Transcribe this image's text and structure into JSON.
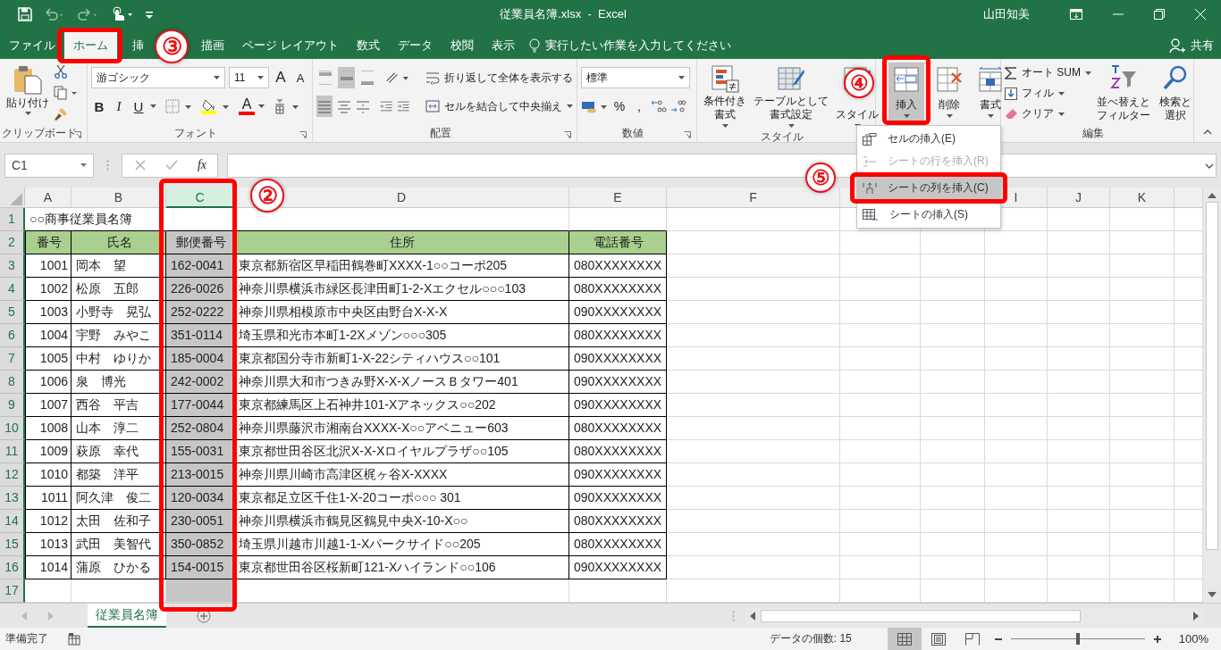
{
  "title_bar": {
    "title": "従業員名簿.xlsx  -  Excel",
    "user": "山田知美"
  },
  "tabs": [
    {
      "label": "ファイル",
      "selected": false,
      "highlighted": false
    },
    {
      "label": "ホーム",
      "selected": true,
      "highlighted": true,
      "callout": "③"
    },
    {
      "label": "挿",
      "selected": false,
      "highlighted": false
    },
    {
      "label": "描画",
      "selected": false,
      "highlighted": false
    },
    {
      "label": "ページ レイアウト",
      "selected": false,
      "highlighted": false
    },
    {
      "label": "数式",
      "selected": false,
      "highlighted": false
    },
    {
      "label": "データ",
      "selected": false,
      "highlighted": false
    },
    {
      "label": "校閲",
      "selected": false,
      "highlighted": false
    },
    {
      "label": "表示",
      "selected": false,
      "highlighted": false
    }
  ],
  "tell_me": {
    "placeholder": "実行したい作業を入力してください"
  },
  "share": "共有",
  "ribbon": {
    "clipboard": {
      "paste": "貼り付け",
      "label": "クリップボード"
    },
    "font": {
      "name": "游ゴシック",
      "size": "11",
      "grow": "A",
      "shrink": "A",
      "bold": "B",
      "italic": "I",
      "underline": "U",
      "font_color": "A",
      "label": "フォント"
    },
    "alignment": {
      "vertical": [
        {
          "selected": false
        },
        {
          "selected": true
        },
        {
          "selected": false
        }
      ],
      "horizontal": [
        {
          "selected": true
        },
        {
          "selected": false
        },
        {
          "selected": false
        }
      ],
      "wrap": "折り返して全体を表示する",
      "merge": "セルを結合して中央揃え",
      "label": "配置"
    },
    "number": {
      "format": "標準",
      "percent": "%",
      "comma": ",",
      "label": "数値"
    },
    "styles": {
      "buttons": [
        {
          "kind": "conditional",
          "lines": [
            "条件付き",
            "書式"
          ]
        },
        {
          "kind": "table",
          "lines": [
            "テーブルとして",
            "書式設定"
          ]
        },
        {
          "kind": "cell",
          "lines": [
            "スタイル"
          ]
        }
      ],
      "label": "スタイル"
    },
    "cells": {
      "buttons": [
        {
          "kind": "insert",
          "label": "挿入",
          "highlighted": true,
          "callout": "④"
        },
        {
          "kind": "delete",
          "label": "削除",
          "highlighted": false
        },
        {
          "kind": "format",
          "label": "書式",
          "highlighted": false
        }
      ]
    },
    "editing": {
      "rows": [
        {
          "kind": "sum",
          "label": "オート SUM"
        },
        {
          "kind": "fill",
          "label": "フィル"
        },
        {
          "kind": "clear",
          "label": "クリア"
        }
      ],
      "sort": [
        "並べ替えと",
        "フィルター"
      ],
      "find": [
        "検索と",
        "選択"
      ],
      "label": "編集"
    }
  },
  "formula_bar": {
    "name_box": "C1",
    "fx": "fx"
  },
  "column_headers": [
    {
      "label": "A",
      "selected": false,
      "highlighted": false
    },
    {
      "label": "B",
      "selected": false,
      "highlighted": false
    },
    {
      "label": "C",
      "selected": true,
      "highlighted": true,
      "callout": "②"
    },
    {
      "label": "D",
      "selected": false,
      "highlighted": false
    },
    {
      "label": "E",
      "selected": false,
      "highlighted": false
    },
    {
      "label": "F",
      "selected": false,
      "highlighted": false
    },
    {
      "label": "I",
      "selected": false,
      "highlighted": false
    },
    {
      "label": "J",
      "selected": false,
      "highlighted": false
    },
    {
      "label": "K",
      "selected": false,
      "highlighted": false
    }
  ],
  "rows": [
    {
      "number": "1",
      "kind": "title",
      "text": "○○商事従業員名簿"
    },
    {
      "number": "2",
      "kind": "header",
      "cells": [
        "番号",
        "氏名",
        "郵便番号",
        "住所",
        "電話番号"
      ]
    },
    {
      "number": "3",
      "kind": "data",
      "cells": [
        "1001",
        "岡本　望",
        "162-0041",
        "東京都新宿区早稲田鶴巻町XXXX-1○○コーポ205",
        "080XXXXXXXX"
      ]
    },
    {
      "number": "4",
      "kind": "data",
      "cells": [
        "1002",
        "松原　五郎",
        "226-0026",
        "神奈川県横浜市緑区長津田町1-2-Xエクセル○○○103",
        "080XXXXXXXX"
      ]
    },
    {
      "number": "5",
      "kind": "data",
      "cells": [
        "1003",
        "小野寺　晃弘",
        "252-0222",
        "神奈川県相模原市中央区由野台X-X-X",
        "090XXXXXXXX"
      ]
    },
    {
      "number": "6",
      "kind": "data",
      "cells": [
        "1004",
        "宇野　みやこ",
        "351-0114",
        "埼玉県和光市本町1-2Xメゾン○○○305",
        "080XXXXXXXX"
      ]
    },
    {
      "number": "7",
      "kind": "data",
      "cells": [
        "1005",
        "中村　ゆりか",
        "185-0004",
        "東京都国分寺市新町1-X-22シティハウス○○101",
        "090XXXXXXXX"
      ]
    },
    {
      "number": "8",
      "kind": "data",
      "cells": [
        "1006",
        "泉　博光",
        "242-0002",
        "神奈川県大和市つきみ野X-X-XノースＢタワー401",
        "090XXXXXXXX"
      ]
    },
    {
      "number": "9",
      "kind": "data",
      "cells": [
        "1007",
        "西谷　平吉",
        "177-0044",
        "東京都練馬区上石神井101-Xアネックス○○202",
        "090XXXXXXXX"
      ]
    },
    {
      "number": "10",
      "kind": "data",
      "cells": [
        "1008",
        "山本　淳二",
        "252-0804",
        "神奈川県藤沢市湘南台XXXX-X○○アベニュー603",
        "080XXXXXXXX"
      ]
    },
    {
      "number": "11",
      "kind": "data",
      "cells": [
        "1009",
        "萩原　幸代",
        "155-0031",
        "東京都世田谷区北沢X-X-Xロイヤルプラザ○○105",
        "080XXXXXXXX"
      ]
    },
    {
      "number": "12",
      "kind": "data",
      "cells": [
        "1010",
        "都築　洋平",
        "213-0015",
        "神奈川県川崎市高津区梶ヶ谷X-XXXX",
        "090XXXXXXXX"
      ]
    },
    {
      "number": "13",
      "kind": "data",
      "cells": [
        "1011",
        "阿久津　俊二",
        "120-0034",
        "東京都足立区千住1-X-20コーポ○○○ 301",
        "090XXXXXXXX"
      ]
    },
    {
      "number": "14",
      "kind": "data",
      "cells": [
        "1012",
        "太田　佐和子",
        "230-0051",
        "神奈川県横浜市鶴見区鶴見中央X-10-X○○",
        "080XXXXXXXX"
      ]
    },
    {
      "number": "15",
      "kind": "data",
      "cells": [
        "1013",
        "武田　美智代",
        "350-0852",
        "埼玉県川越市川越1-1-Xパークサイド○○205",
        "080XXXXXXXX"
      ]
    },
    {
      "number": "16",
      "kind": "data",
      "cells": [
        "1014",
        "蒲原　ひかる",
        "154-0015",
        "東京都世田谷区桜新町121-Xハイランド○○106",
        "090XXXXXXXX"
      ]
    },
    {
      "number": "17",
      "kind": "empty"
    }
  ],
  "menu": {
    "items": [
      {
        "kind": "cell",
        "label": "セルの挿入(E)",
        "disabled": false,
        "selected": false,
        "highlighted": false
      },
      {
        "kind": "row",
        "label": "シートの行を挿入(R)",
        "disabled": true,
        "selected": false,
        "highlighted": false
      },
      {
        "kind": "column",
        "label": "シートの列を挿入(C)",
        "disabled": false,
        "selected": true,
        "highlighted": true,
        "callout": "⑤"
      },
      {
        "kind": "sheet",
        "label": "シートの挿入(S)",
        "disabled": false,
        "selected": false,
        "highlighted": false
      }
    ]
  },
  "sheet_tabs": [
    {
      "label": "従業員名簿",
      "selected": true
    }
  ],
  "status_bar": {
    "status": "準備完了",
    "count": "データの個数: 15",
    "views": [
      {
        "kind": "normal",
        "selected": true
      },
      {
        "kind": "layout",
        "selected": false
      },
      {
        "kind": "break",
        "selected": false
      }
    ],
    "zoom": {
      "level": 0.5,
      "reading": "100%"
    }
  }
}
